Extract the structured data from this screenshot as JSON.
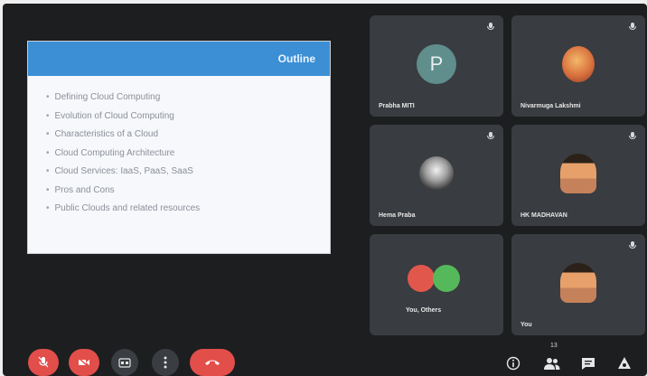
{
  "slide": {
    "title": "Outline",
    "bullets": [
      "Defining Cloud Computing",
      "Evolution of Cloud Computing",
      "Characteristics of a Cloud",
      "Cloud Computing Architecture",
      "Cloud Services: IaaS, PaaS, SaaS",
      "Pros and Cons",
      "Public Clouds and related resources"
    ]
  },
  "participants": [
    {
      "name": "Prabha MITI",
      "avatar": "letter",
      "initial": "P"
    },
    {
      "name": "Nivarmuga Lakshmi",
      "avatar": "photo"
    },
    {
      "name": "Hema Praba",
      "avatar": "photo"
    },
    {
      "name": "HK MADHAVAN",
      "avatar": "person"
    },
    {
      "name": "You, Others",
      "avatar": "pair"
    },
    {
      "name": "You",
      "avatar": "person"
    }
  ],
  "controls": {
    "participant_count": "13"
  },
  "colors": {
    "accent": "#3c8fd4",
    "end_call": "#e24e4a",
    "tile": "#393c40"
  },
  "icons": [
    "mic-off-icon",
    "video-off-icon",
    "captions-icon",
    "more-options-icon",
    "end-call-icon",
    "info-icon",
    "people-icon",
    "chat-icon",
    "activities-icon"
  ]
}
